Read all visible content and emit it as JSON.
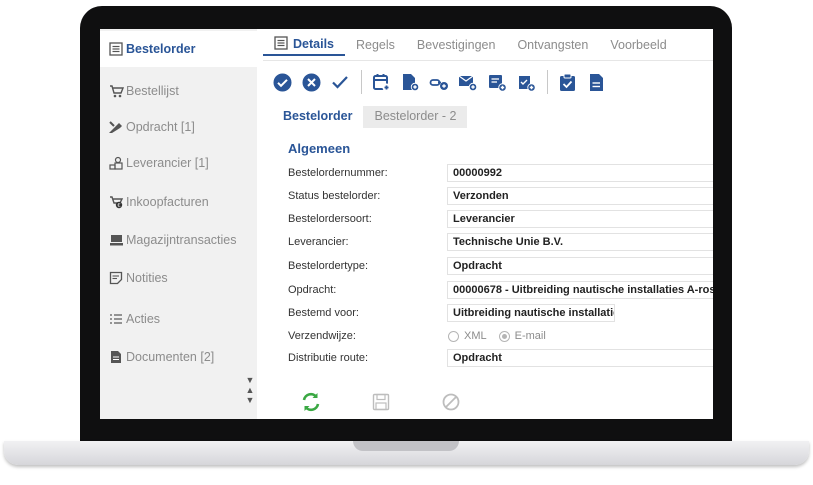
{
  "sidebar": {
    "items": [
      {
        "label": "Bestelorder",
        "icon": "order-list-icon",
        "active": true
      },
      {
        "label": "Bestellijst",
        "icon": "cart-icon"
      },
      {
        "label": "Opdracht [1]",
        "icon": "tools-icon"
      },
      {
        "label": "Leverancier [1]",
        "icon": "supplier-icon"
      },
      {
        "label": "Inkoopfacturen",
        "icon": "invoice-icon"
      },
      {
        "label": "Magazijntransacties",
        "icon": "warehouse-icon"
      },
      {
        "label": "Notities",
        "icon": "note-icon"
      },
      {
        "label": "Acties",
        "icon": "list-icon"
      },
      {
        "label": "Documenten [2]",
        "icon": "document-icon"
      }
    ]
  },
  "tabs": [
    {
      "label": "Details",
      "active": true
    },
    {
      "label": "Regels"
    },
    {
      "label": "Bevestigingen"
    },
    {
      "label": "Ontvangsten"
    },
    {
      "label": "Voorbeeld"
    }
  ],
  "subtabs": [
    {
      "label": "Bestelorder",
      "active": true
    },
    {
      "label": "Bestelorder - 2"
    }
  ],
  "section": {
    "title": "Algemeen"
  },
  "form": {
    "bestelordernummer": {
      "label": "Bestelordernummer:",
      "value": "00000992"
    },
    "status": {
      "label": "Status bestelorder:",
      "value": "Verzonden"
    },
    "soort": {
      "label": "Bestelordersoort:",
      "value": "Leverancier"
    },
    "leverancier": {
      "label": "Leverancier:",
      "value": "Technische Unie B.V."
    },
    "type": {
      "label": "Bestelordertype:",
      "value": "Opdracht"
    },
    "opdracht": {
      "label": "Opdracht:",
      "value": "00000678 - Uitbreiding nautische installaties A-ros"
    },
    "bestemd": {
      "label": "Bestemd voor:",
      "value": "Uitbreiding nautische installatie"
    },
    "verzendwijze": {
      "label": "Verzendwijze:",
      "option1": "XML",
      "option2": "E-mail",
      "selected": "E-mail"
    },
    "distributie": {
      "label": "Distributie route:",
      "value": "Opdracht"
    }
  },
  "colors": {
    "accent": "#2a5597",
    "green": "#3aa843",
    "muted": "#8c8c8c"
  }
}
